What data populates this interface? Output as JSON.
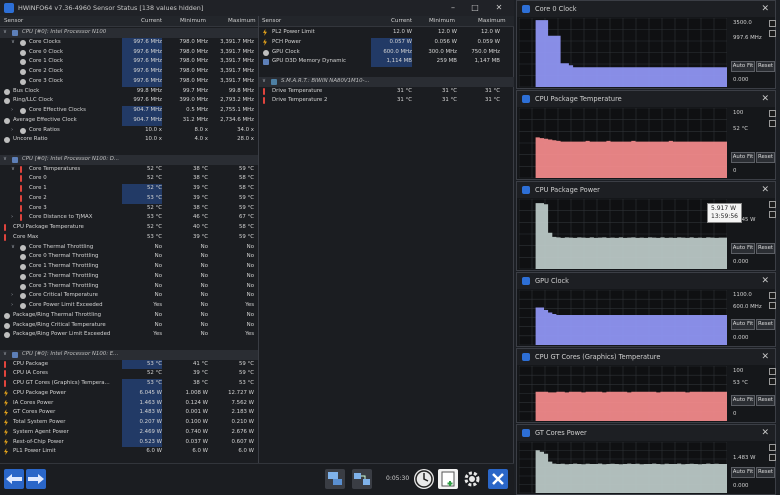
{
  "window": {
    "title": "HWiNFO64 v7.36-4960 Sensor Status [138 values hidden]"
  },
  "columns": {
    "sensor": "Sensor",
    "current": "Current",
    "minimum": "Minimum",
    "maximum": "Maximum"
  },
  "left_rows": [
    {
      "type": "group",
      "label": "CPU [#0]: Intel Processor N100"
    },
    {
      "icon": "clock",
      "indent": 1,
      "exp": "v",
      "label": "Core Clocks",
      "cur": "997.6 MHz",
      "min": "798.0 MHz",
      "max": "3,391.7 MHz",
      "hl": true
    },
    {
      "icon": "clock",
      "indent": 2,
      "label": "Core 0 Clock",
      "cur": "997.6 MHz",
      "min": "798.0 MHz",
      "max": "3,391.7 MHz",
      "hl": true
    },
    {
      "icon": "clock",
      "indent": 2,
      "label": "Core 1 Clock",
      "cur": "997.6 MHz",
      "min": "798.0 MHz",
      "max": "3,391.7 MHz",
      "hl": true
    },
    {
      "icon": "clock",
      "indent": 2,
      "label": "Core 2 Clock",
      "cur": "997.6 MHz",
      "min": "798.0 MHz",
      "max": "3,391.7 MHz",
      "hl": true
    },
    {
      "icon": "clock",
      "indent": 2,
      "label": "Core 3 Clock",
      "cur": "997.6 MHz",
      "min": "798.0 MHz",
      "max": "3,391.7 MHz",
      "hl": true
    },
    {
      "icon": "clock",
      "indent": 0,
      "label": "Bus Clock",
      "cur": "99.8 MHz",
      "min": "99.7 MHz",
      "max": "99.8 MHz"
    },
    {
      "icon": "clock",
      "indent": 0,
      "label": "Ring/LLC Clock",
      "cur": "997.6 MHz",
      "min": "399.0 MHz",
      "max": "2,793.2 MHz"
    },
    {
      "icon": "clock",
      "indent": 1,
      "exp": ">",
      "label": "Core Effective Clocks",
      "cur": "904.7 MHz",
      "min": "0.5 MHz",
      "max": "2,755.1 MHz",
      "hl": true
    },
    {
      "icon": "clock",
      "indent": 0,
      "label": "Average Effective Clock",
      "cur": "904.7 MHz",
      "min": "31.2 MHz",
      "max": "2,734.6 MHz",
      "hl": true
    },
    {
      "icon": "clock",
      "indent": 1,
      "exp": ">",
      "label": "Core Ratios",
      "cur": "10.0 x",
      "min": "8.0 x",
      "max": "34.0 x"
    },
    {
      "icon": "clock",
      "indent": 0,
      "label": "Uncore Ratio",
      "cur": "10.0 x",
      "min": "4.0 x",
      "max": "28.0 x"
    },
    {
      "type": "blank"
    },
    {
      "type": "group",
      "label": "CPU [#0]: Intel Processor N100: D..."
    },
    {
      "icon": "therm",
      "indent": 1,
      "exp": "v",
      "label": "Core Temperatures",
      "cur": "52 °C",
      "min": "38 °C",
      "max": "59 °C"
    },
    {
      "icon": "therm",
      "indent": 2,
      "label": "Core 0",
      "cur": "52 °C",
      "min": "38 °C",
      "max": "58 °C"
    },
    {
      "icon": "therm",
      "indent": 2,
      "label": "Core 1",
      "cur": "52 °C",
      "min": "39 °C",
      "max": "58 °C",
      "hl": true
    },
    {
      "icon": "therm",
      "indent": 2,
      "label": "Core 2",
      "cur": "53 °C",
      "min": "39 °C",
      "max": "59 °C",
      "hl": true
    },
    {
      "icon": "therm",
      "indent": 2,
      "label": "Core 3",
      "cur": "52 °C",
      "min": "38 °C",
      "max": "59 °C"
    },
    {
      "icon": "therm",
      "indent": 1,
      "exp": ">",
      "label": "Core Distance to TjMAX",
      "cur": "53 °C",
      "min": "46 °C",
      "max": "67 °C"
    },
    {
      "icon": "therm",
      "indent": 0,
      "label": "CPU Package Temperature",
      "cur": "52 °C",
      "min": "40 °C",
      "max": "58 °C"
    },
    {
      "icon": "therm",
      "indent": 0,
      "label": "Core Max",
      "cur": "53 °C",
      "min": "39 °C",
      "max": "59 °C"
    },
    {
      "icon": "clock",
      "indent": 1,
      "exp": "v",
      "label": "Core Thermal Throttling",
      "cur": "No",
      "min": "No",
      "max": "No"
    },
    {
      "icon": "clock",
      "indent": 2,
      "label": "Core 0 Thermal Throttling",
      "cur": "No",
      "min": "No",
      "max": "No"
    },
    {
      "icon": "clock",
      "indent": 2,
      "label": "Core 1 Thermal Throttling",
      "cur": "No",
      "min": "No",
      "max": "No"
    },
    {
      "icon": "clock",
      "indent": 2,
      "label": "Core 2 Thermal Throttling",
      "cur": "No",
      "min": "No",
      "max": "No"
    },
    {
      "icon": "clock",
      "indent": 2,
      "label": "Core 3 Thermal Throttling",
      "cur": "No",
      "min": "No",
      "max": "No"
    },
    {
      "icon": "clock",
      "indent": 1,
      "exp": ">",
      "label": "Core Critical Temperature",
      "cur": "No",
      "min": "No",
      "max": "No"
    },
    {
      "icon": "clock",
      "indent": 1,
      "exp": ">",
      "label": "Core Power Limit Exceeded",
      "cur": "Yes",
      "min": "No",
      "max": "Yes"
    },
    {
      "icon": "clock",
      "indent": 0,
      "label": "Package/Ring Thermal Throttling",
      "cur": "No",
      "min": "No",
      "max": "No"
    },
    {
      "icon": "clock",
      "indent": 0,
      "label": "Package/Ring Critical Temperature",
      "cur": "No",
      "min": "No",
      "max": "No"
    },
    {
      "icon": "clock",
      "indent": 0,
      "label": "Package/Ring Power Limit Exceeded",
      "cur": "Yes",
      "min": "No",
      "max": "Yes"
    },
    {
      "type": "blank"
    },
    {
      "type": "group",
      "label": "CPU [#0]: Intel Processor N100: E..."
    },
    {
      "icon": "therm",
      "indent": 0,
      "label": "CPU Package",
      "cur": "53 °C",
      "min": "41 °C",
      "max": "59 °C",
      "hl": true
    },
    {
      "icon": "therm",
      "indent": 0,
      "label": "CPU IA Cores",
      "cur": "52 °C",
      "min": "39 °C",
      "max": "59 °C"
    },
    {
      "icon": "therm",
      "indent": 0,
      "label": "CPU GT Cores (Graphics) Tempera...",
      "cur": "53 °C",
      "min": "38 °C",
      "max": "53 °C",
      "hl": true
    },
    {
      "icon": "bolt",
      "indent": 0,
      "label": "CPU Package Power",
      "cur": "6.045 W",
      "min": "1.008 W",
      "max": "12.727 W",
      "hl": true
    },
    {
      "icon": "bolt",
      "indent": 0,
      "label": "IA Cores Power",
      "cur": "1.463 W",
      "min": "0.124 W",
      "max": "7.562 W",
      "hl": true
    },
    {
      "icon": "bolt",
      "indent": 0,
      "label": "GT Cores Power",
      "cur": "1.483 W",
      "min": "0.001 W",
      "max": "2.183 W",
      "hl": true
    },
    {
      "icon": "bolt",
      "indent": 0,
      "label": "Total System Power",
      "cur": "0.207 W",
      "min": "0.100 W",
      "max": "0.210 W",
      "hl": true
    },
    {
      "icon": "bolt",
      "indent": 0,
      "label": "System Agent Power",
      "cur": "2.469 W",
      "min": "0.740 W",
      "max": "2.676 W",
      "hl": true
    },
    {
      "icon": "bolt",
      "indent": 0,
      "label": "Rest-of-Chip Power",
      "cur": "0.523 W",
      "min": "0.037 W",
      "max": "0.607 W",
      "hl": true
    },
    {
      "icon": "bolt",
      "indent": 0,
      "label": "PL1 Power Limit",
      "cur": "6.0 W",
      "min": "6.0 W",
      "max": "6.0 W"
    }
  ],
  "right_rows": [
    {
      "icon": "bolt",
      "indent": 0,
      "label": "PL2 Power Limit",
      "cur": "12.0 W",
      "min": "12.0 W",
      "max": "12.0 W"
    },
    {
      "icon": "bolt",
      "indent": 0,
      "label": "PCH Power",
      "cur": "0.057 W",
      "min": "0.056 W",
      "max": "0.059 W",
      "hl": true
    },
    {
      "icon": "clock",
      "indent": 0,
      "label": "GPU Clock",
      "cur": "600.0 MHz",
      "min": "300.0 MHz",
      "max": "750.0 MHz",
      "hl": true
    },
    {
      "icon": "chip",
      "indent": 0,
      "label": "GPU D3D Memory Dynamic",
      "cur": "1,114 MB",
      "min": "259 MB",
      "max": "1,147 MB",
      "hl": true
    },
    {
      "type": "blank"
    },
    {
      "type": "group",
      "icon": "disk",
      "label": "S.M.A.R.T.: BIWIN NA80V1M10-..."
    },
    {
      "icon": "therm",
      "indent": 0,
      "label": "Drive Temperature",
      "cur": "31 °C",
      "min": "31 °C",
      "max": "31 °C"
    },
    {
      "icon": "therm",
      "indent": 0,
      "label": "Drive Temperature 2",
      "cur": "31 °C",
      "min": "31 °C",
      "max": "31 °C"
    }
  ],
  "bottom": {
    "timer": "0:05:30"
  },
  "graphs": [
    {
      "title": "Core 0 Clock",
      "top_label": "3500.0",
      "cur_label": "997.6 MHz",
      "bottom_label": "0.000",
      "color": "#8f95f2",
      "ymax": 3500,
      "samples": [
        0,
        0,
        0,
        0,
        3391,
        3391,
        3391,
        2600,
        2600,
        2600,
        1200,
        1200,
        1100,
        1000,
        998,
        998,
        998,
        998,
        998,
        998,
        998,
        998,
        998,
        998,
        998,
        998,
        998,
        998,
        998,
        998,
        998,
        998,
        998,
        998,
        998,
        998,
        998,
        998,
        998,
        998,
        998,
        998,
        998,
        998,
        998,
        998,
        998,
        998,
        998,
        998
      ]
    },
    {
      "title": "CPU Package Temperature",
      "top_label": "100",
      "cur_label": "52 °C",
      "bottom_label": "0",
      "color": "#f0898a",
      "ymax": 100,
      "samples": [
        0,
        0,
        0,
        0,
        58,
        57,
        56,
        55,
        54,
        53,
        52,
        52,
        52,
        52,
        52,
        52,
        53,
        52,
        52,
        52,
        52,
        53,
        52,
        52,
        52,
        52,
        52,
        53,
        52,
        52,
        52,
        52,
        52,
        52,
        52,
        52,
        53,
        52,
        52,
        52,
        52,
        52,
        52,
        52,
        52,
        52,
        52,
        52,
        52,
        52
      ]
    },
    {
      "title": "CPU Package Power",
      "top_label": "",
      "cur_label": "6.045 W",
      "bottom_label": "0.000",
      "color": "#b9c7c5",
      "ymax": 13.5,
      "tooltip": [
        "5.917 W",
        "13:59:56"
      ],
      "samples": [
        0,
        0,
        0,
        0,
        12.7,
        12.7,
        12.5,
        7,
        6.2,
        6.1,
        6.0,
        6.1,
        6.05,
        6.0,
        6.1,
        6.05,
        6.0,
        6.1,
        6.0,
        6.05,
        6.1,
        6.0,
        6.05,
        6.0,
        6.1,
        6.0,
        6.05,
        6.1,
        6.0,
        6.05,
        6.0,
        6.1,
        6.05,
        6.0,
        6.1,
        6.0,
        6.05,
        6.0,
        6.1,
        6.05,
        6.0,
        6.1,
        6.0,
        6.05,
        6.0,
        6.1,
        6.05,
        6.0,
        6.05,
        6.05
      ]
    },
    {
      "title": "GPU Clock",
      "top_label": "1100.0",
      "cur_label": "600.0 MHz",
      "bottom_label": "0.000",
      "color": "#8f95f2",
      "ymax": 1100,
      "samples": [
        0,
        0,
        0,
        0,
        750,
        750,
        700,
        650,
        620,
        600,
        600,
        600,
        600,
        600,
        600,
        600,
        600,
        600,
        600,
        600,
        600,
        600,
        600,
        600,
        600,
        600,
        600,
        600,
        600,
        600,
        600,
        600,
        600,
        600,
        600,
        600,
        600,
        600,
        600,
        600,
        600,
        600,
        600,
        600,
        600,
        600,
        600,
        600,
        600,
        600
      ]
    },
    {
      "title": "CPU GT Cores (Graphics) Temperature",
      "top_label": "100",
      "cur_label": "53 °C",
      "bottom_label": "0",
      "color": "#f0898a",
      "ymax": 100,
      "samples": [
        0,
        0,
        0,
        0,
        53,
        53,
        53,
        52,
        52,
        53,
        53,
        52,
        53,
        53,
        53,
        52,
        53,
        53,
        53,
        53,
        52,
        53,
        53,
        53,
        53,
        53,
        52,
        53,
        53,
        53,
        53,
        53,
        53,
        52,
        53,
        53,
        53,
        53,
        53,
        53,
        52,
        53,
        53,
        53,
        53,
        53,
        53,
        53,
        53,
        53
      ]
    },
    {
      "title": "GT Cores Power",
      "top_label": "",
      "cur_label": "1.483 W",
      "bottom_label": "0.000",
      "color": "#b9c7c5",
      "ymax": 2.6,
      "samples": [
        0,
        0,
        0,
        0,
        2.18,
        2.1,
        2.0,
        1.6,
        1.5,
        1.48,
        1.49,
        1.47,
        1.48,
        1.5,
        1.48,
        1.47,
        1.49,
        1.48,
        1.48,
        1.5,
        1.47,
        1.48,
        1.49,
        1.48,
        1.47,
        1.48,
        1.5,
        1.48,
        1.49,
        1.47,
        1.48,
        1.48,
        1.5,
        1.48,
        1.47,
        1.49,
        1.48,
        1.48,
        1.5,
        1.47,
        1.48,
        1.49,
        1.48,
        1.47,
        1.48,
        1.5,
        1.48,
        1.49,
        1.48,
        1.48
      ]
    }
  ],
  "graph_buttons": {
    "autofit": "Auto Fit",
    "reset": "Reset"
  }
}
